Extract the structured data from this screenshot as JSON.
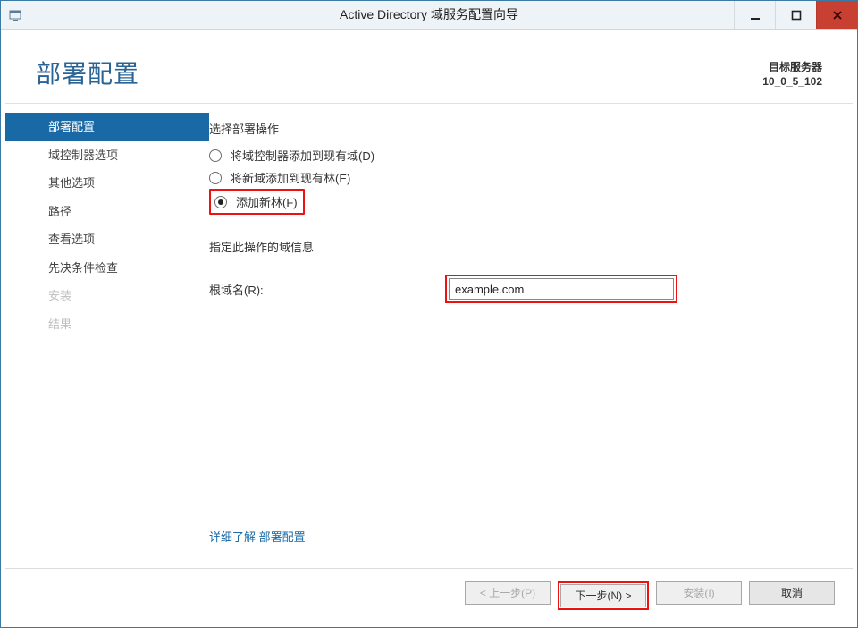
{
  "titlebar": {
    "title": "Active Directory 域服务配置向导"
  },
  "header": {
    "page_title": "部署配置",
    "target_label": "目标服务器",
    "target_value": "10_0_5_102"
  },
  "sidebar": {
    "items": [
      {
        "label": "部署配置",
        "state": "active"
      },
      {
        "label": "域控制器选项",
        "state": "normal"
      },
      {
        "label": "其他选项",
        "state": "normal"
      },
      {
        "label": "路径",
        "state": "normal"
      },
      {
        "label": "查看选项",
        "state": "normal"
      },
      {
        "label": "先决条件检查",
        "state": "normal"
      },
      {
        "label": "安装",
        "state": "disabled"
      },
      {
        "label": "结果",
        "state": "disabled"
      }
    ]
  },
  "main": {
    "operation_heading": "选择部署操作",
    "radios": [
      {
        "label": "将域控制器添加到现有域(D)",
        "checked": false,
        "highlight": false
      },
      {
        "label": "将新域添加到现有林(E)",
        "checked": false,
        "highlight": false
      },
      {
        "label": "添加新林(F)",
        "checked": true,
        "highlight": true
      }
    ],
    "domain_info_heading": "指定此操作的域信息",
    "root_domain_label": "根域名(R):",
    "root_domain_value": "example.com",
    "more_link_prefix": "详细了解",
    "more_link_topic": "部署配置"
  },
  "buttons": {
    "prev": "< 上一步(P)",
    "next": "下一步(N) >",
    "install": "安装(I)",
    "cancel": "取消"
  }
}
